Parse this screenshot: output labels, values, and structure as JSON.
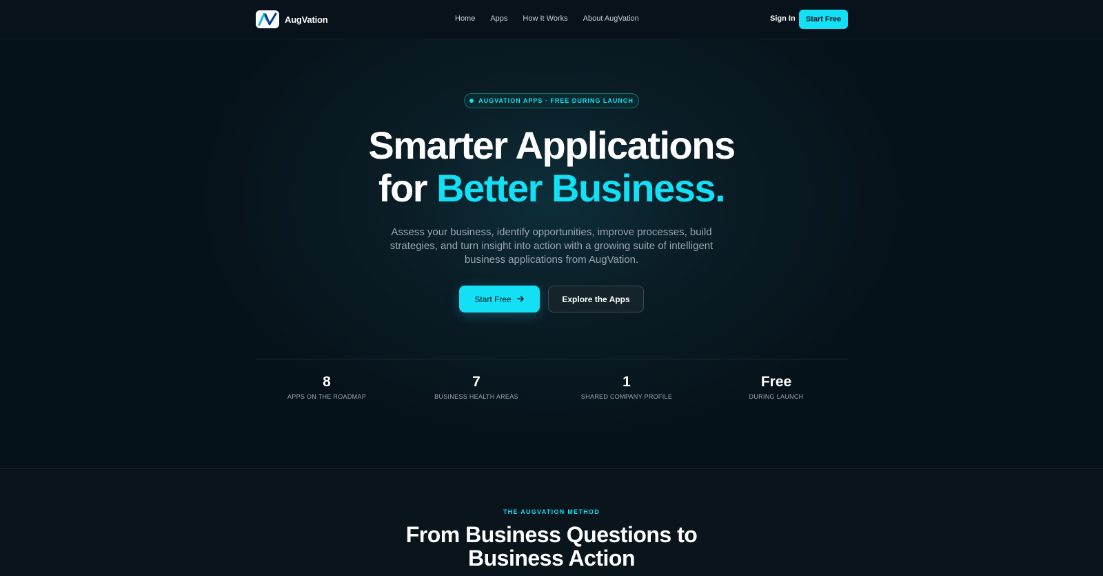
{
  "nav": {
    "brand": "AugVation",
    "links": [
      "Home",
      "Apps",
      "How It Works",
      "About AugVation"
    ],
    "signin": "Sign In",
    "cta": "Start Free"
  },
  "hero": {
    "badge": "AUGVATION APPS · FREE DURING LAUNCH",
    "headline_line1": "Smarter Applications",
    "headline_line2_prefix": "for ",
    "headline_line2_accent": "Better Business.",
    "subtitle": "Assess your business, identify opportunities, improve processes, build strategies, and turn insight into action with a growing suite of intelligent business applications from AugVation.",
    "primary_button": "Start Free",
    "secondary_button": "Explore the Apps"
  },
  "stats": [
    {
      "value": "8",
      "label": "APPS ON THE ROADMAP"
    },
    {
      "value": "7",
      "label": "BUSINESS HEALTH AREAS"
    },
    {
      "value": "1",
      "label": "SHARED COMPANY PROFILE"
    },
    {
      "value": "Free",
      "label": "DURING LAUNCH"
    }
  ],
  "method": {
    "eyebrow": "THE AUGVATION METHOD",
    "title_line1": "From Business Questions to",
    "title_line2": "Business Action"
  },
  "colors": {
    "accent": "#14e0f5",
    "background": "#050c12"
  },
  "icons": [
    "augvation-logo-icon",
    "arrow-right-icon"
  ]
}
